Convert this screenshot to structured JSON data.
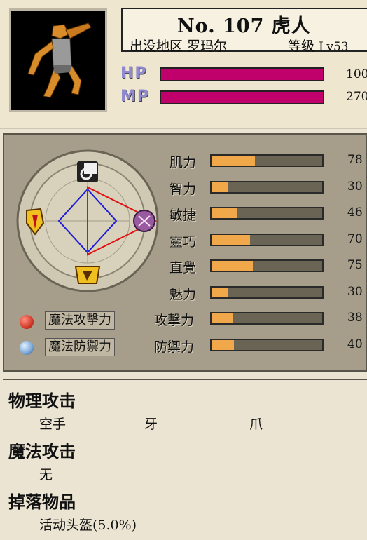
{
  "monster": {
    "number": "No. 107",
    "name": "虎人",
    "region_label": "出没地区",
    "region": "罗玛尔",
    "level_label": "等级",
    "level": "Lv53"
  },
  "hp": {
    "label": "HP",
    "value": "100",
    "fraction": 1.0
  },
  "mp": {
    "label": "MP",
    "value": "270",
    "fraction": 1.0
  },
  "stats": [
    {
      "label": "肌力",
      "value": "78",
      "fraction": 0.39
    },
    {
      "label": "智力",
      "value": "30",
      "fraction": 0.15
    },
    {
      "label": "敏捷",
      "value": "46",
      "fraction": 0.23
    },
    {
      "label": "靈巧",
      "value": "70",
      "fraction": 0.35
    },
    {
      "label": "直覺",
      "value": "75",
      "fraction": 0.375
    },
    {
      "label": "魅力",
      "value": "30",
      "fraction": 0.15
    },
    {
      "label": "攻擊力",
      "value": "38",
      "fraction": 0.19
    },
    {
      "label": "防禦力",
      "value": "40",
      "fraction": 0.2
    }
  ],
  "magic": {
    "attack_label": "魔法攻擊力",
    "defense_label": "魔法防禦力"
  },
  "sections": {
    "physical_title": "物理攻击",
    "physical_items": [
      "空手",
      "牙",
      "爪"
    ],
    "magic_title": "魔法攻击",
    "magic_items": [
      "无"
    ],
    "drop_title": "掉落物品",
    "drop_items": [
      "活动头盔(5.0%)"
    ]
  },
  "colors": {
    "hpmp_bar": "#c0006b",
    "stat_bar": "#f0a84a",
    "attack_orb": "#d43a2a",
    "defense_orb": "#7aa7d8"
  }
}
